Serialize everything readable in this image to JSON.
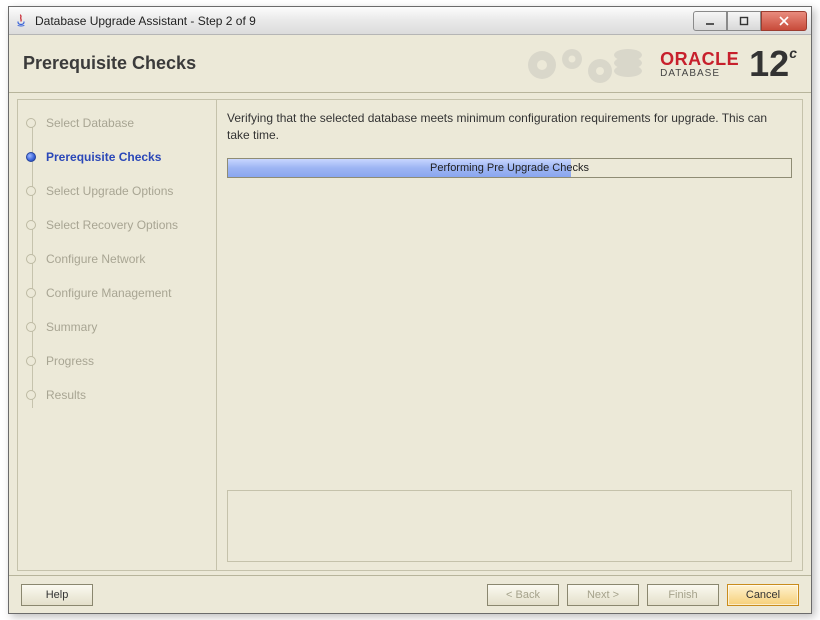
{
  "window": {
    "title": "Database Upgrade Assistant - Step 2 of 9"
  },
  "header": {
    "title": "Prerequisite Checks"
  },
  "brand": {
    "name": "ORACLE",
    "sub": "DATABASE",
    "version": "12",
    "suffix": "c"
  },
  "sidebar": {
    "steps": [
      {
        "label": "Select Database",
        "active": false
      },
      {
        "label": "Prerequisite Checks",
        "active": true
      },
      {
        "label": "Select Upgrade Options",
        "active": false
      },
      {
        "label": "Select Recovery Options",
        "active": false
      },
      {
        "label": "Configure Network",
        "active": false
      },
      {
        "label": "Configure Management",
        "active": false
      },
      {
        "label": "Summary",
        "active": false
      },
      {
        "label": "Progress",
        "active": false
      },
      {
        "label": "Results",
        "active": false
      }
    ]
  },
  "main": {
    "instruction": "Verifying that the selected database meets minimum configuration requirements for upgrade. This can take time.",
    "progress": {
      "label": "Performing Pre Upgrade Checks",
      "percent": 61
    }
  },
  "footer": {
    "help": "Help",
    "back": "< Back",
    "next": "Next >",
    "finish": "Finish",
    "cancel": "Cancel"
  }
}
